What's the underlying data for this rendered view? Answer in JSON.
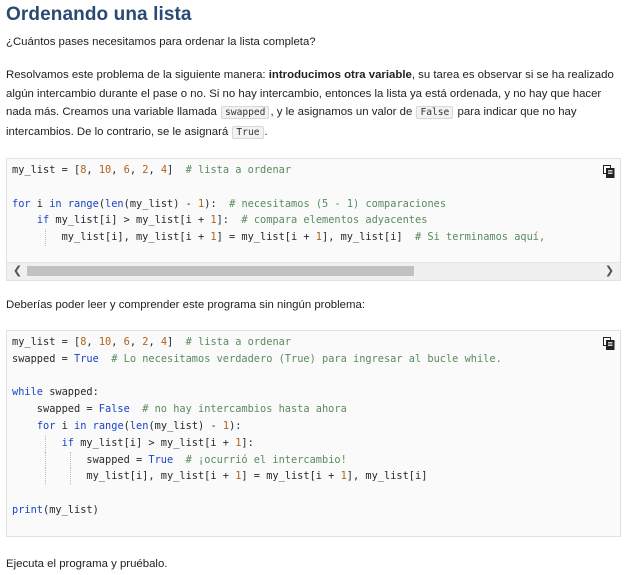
{
  "title": "Ordenando una lista",
  "question": "¿Cuántos pases necesitamos para ordenar la lista completa?",
  "explanation": {
    "part1": "Resolvamos este problema de la siguiente manera: ",
    "bold": "introducimos otra variable",
    "part2": ", su tarea es observar si se ha realizado algún intercambio durante el pase o no. Si no hay intercambio, entonces la lista ya está ordenada, y no hay que hacer nada más. Creamos una variable llamada ",
    "code1": "swapped",
    "part3": ", y le asignamos un valor de ",
    "code2": "False",
    "part4": " para indicar que no hay intercambios. De lo contrario, se le asignará ",
    "code3": "True",
    "part5": "."
  },
  "code_block_1": {
    "copy_icon": "copy-icon",
    "scroll_left_icon": "chevron-left-icon",
    "scroll_right_icon": "chevron-right-icon"
  },
  "middle_text": "Deberías poder leer y comprender este programa sin ningún problema:",
  "code_block_2": {
    "copy_icon": "copy-icon"
  },
  "footer_text": "Ejecuta el programa y pruébalo."
}
